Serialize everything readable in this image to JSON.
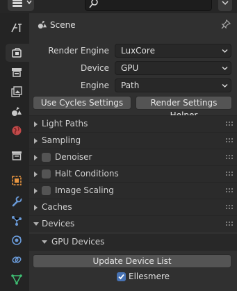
{
  "header": {
    "editor_type_icon": "properties-editor-icon",
    "search": {
      "placeholder": "",
      "icon": "search-icon"
    },
    "options_icon": "chevron-down-icon"
  },
  "tabs": [
    {
      "name": "tool",
      "icon": "tool-icon",
      "active": false
    },
    {
      "name": "render",
      "icon": "render-icon",
      "active": true
    },
    {
      "name": "output",
      "icon": "output-icon",
      "active": false
    },
    {
      "name": "view-layer",
      "icon": "view-layer-icon",
      "active": false
    },
    {
      "name": "scene",
      "icon": "scene-icon",
      "active": false
    },
    {
      "name": "world",
      "icon": "world-icon",
      "active": false
    },
    {
      "name": "collection",
      "icon": "collection-icon",
      "active": false
    },
    {
      "name": "object",
      "icon": "object-icon",
      "active": false
    },
    {
      "name": "modifiers",
      "icon": "wrench-icon",
      "active": false
    },
    {
      "name": "particles",
      "icon": "particles-icon",
      "active": false
    },
    {
      "name": "physics",
      "icon": "physics-icon",
      "active": false
    },
    {
      "name": "constraints",
      "icon": "constraints-icon",
      "active": false
    },
    {
      "name": "data",
      "icon": "mesh-data-icon",
      "active": false
    }
  ],
  "context": {
    "title": "Scene"
  },
  "settings": {
    "render_engine": {
      "label": "Render Engine",
      "value": "LuxCore"
    },
    "device": {
      "label": "Device",
      "value": "GPU"
    },
    "engine": {
      "label": "Engine",
      "value": "Path"
    }
  },
  "buttons": {
    "use_cycles": "Use Cycles Settings",
    "render_helper": "Render Settings Helper",
    "update_devices": "Update Device List"
  },
  "panels": [
    {
      "title": "Light Paths",
      "expanded": false,
      "checkbox": false
    },
    {
      "title": "Sampling",
      "expanded": false,
      "checkbox": false
    },
    {
      "title": "Denoiser",
      "expanded": false,
      "checkbox": true,
      "checked": false
    },
    {
      "title": "Halt Conditions",
      "expanded": false,
      "checkbox": true,
      "checked": false
    },
    {
      "title": "Image Scaling",
      "expanded": false,
      "checkbox": true,
      "checked": false
    },
    {
      "title": "Caches",
      "expanded": false,
      "checkbox": false
    },
    {
      "title": "Devices",
      "expanded": true,
      "checkbox": false
    }
  ],
  "subpanel": {
    "title": "GPU Devices",
    "expanded": true
  },
  "device_entry": {
    "label": "Ellesmere",
    "checked": true
  },
  "colors": {
    "background": "#303030",
    "tab_column": "#242424",
    "panel_header": "#2b2b2b",
    "checkbox_on": "#4772b3",
    "button": "#545454"
  }
}
